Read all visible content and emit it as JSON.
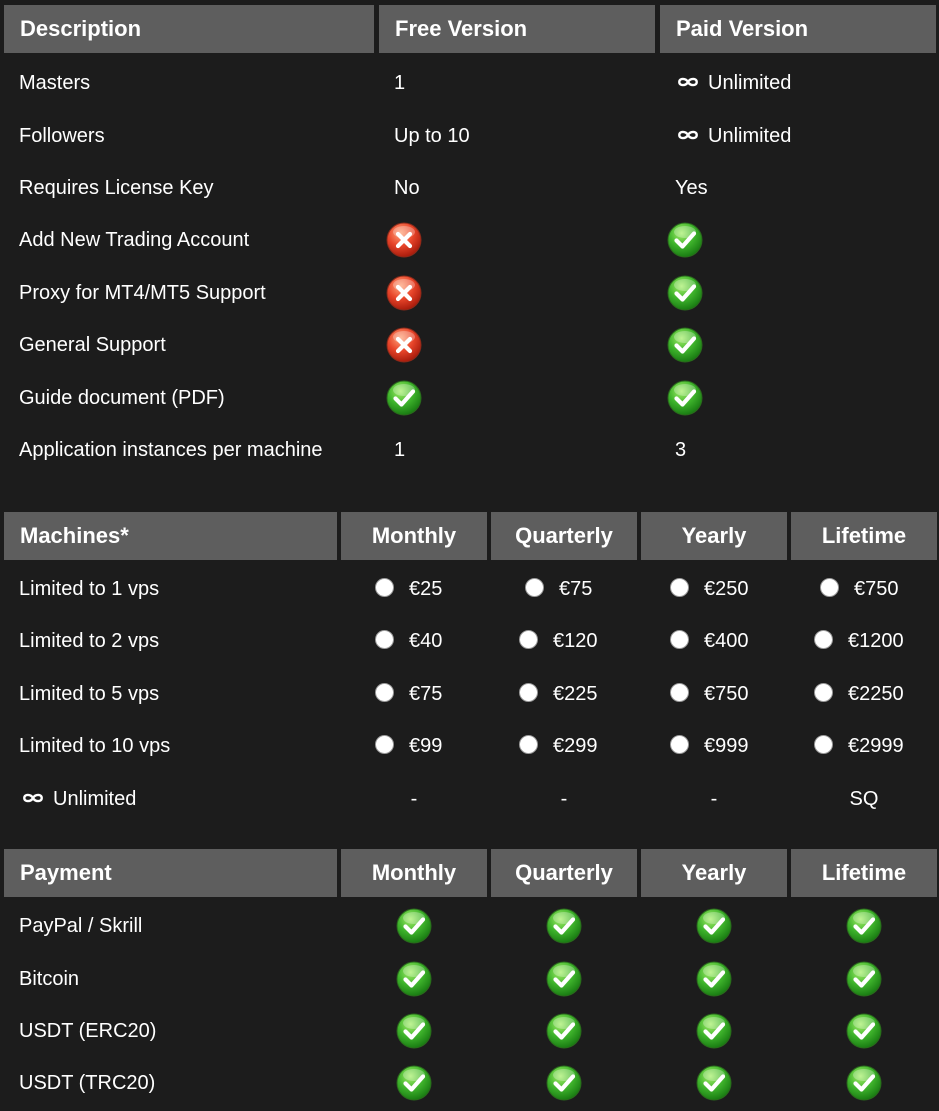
{
  "features": {
    "headers": [
      "Description",
      "Free Version",
      "Paid Version"
    ],
    "rows": [
      {
        "label": "Masters",
        "free": "1",
        "paid": "Unlimited",
        "paid_icon": "infinity-icon"
      },
      {
        "label": "Followers",
        "free": "Up to 10",
        "paid": "Unlimited",
        "paid_icon": "infinity-icon"
      },
      {
        "label": "Requires License Key",
        "free": "No",
        "paid": "Yes"
      },
      {
        "label": "Add New Trading Account",
        "free_icon": "cross-icon",
        "paid_icon": "check-icon"
      },
      {
        "label": "Proxy for MT4/MT5 Support",
        "free_icon": "cross-icon",
        "paid_icon": "check-icon"
      },
      {
        "label": "General Support",
        "free_icon": "cross-icon",
        "paid_icon": "check-icon"
      },
      {
        "label": "Guide document (PDF)",
        "free_icon": "check-icon",
        "paid_icon": "check-icon"
      },
      {
        "label": "Application instances per machine",
        "free": "1",
        "paid": "3"
      }
    ]
  },
  "machines": {
    "headers": [
      "Machines*",
      "Monthly",
      "Quarterly",
      "Yearly",
      "Lifetime"
    ],
    "rows": [
      {
        "label": "Limited to 1 vps",
        "prices": [
          "€25",
          "€75",
          "€250",
          "€750"
        ]
      },
      {
        "label": "Limited to 2 vps",
        "prices": [
          "€40",
          "€120",
          "€400",
          "€1200"
        ]
      },
      {
        "label": "Limited to 5 vps",
        "prices": [
          "€75",
          "€225",
          "€750",
          "€2250"
        ]
      },
      {
        "label": "Limited to 10 vps",
        "prices": [
          "€99",
          "€299",
          "€999",
          "€2999"
        ]
      }
    ],
    "unlimited": {
      "label": "Unlimited",
      "icon": "infinity-icon",
      "values": [
        "-",
        "-",
        "-",
        "SQ"
      ]
    }
  },
  "payment": {
    "headers": [
      "Payment",
      "Monthly",
      "Quarterly",
      "Yearly",
      "Lifetime"
    ],
    "rows": [
      {
        "label": "PayPal / Skrill",
        "icon": "check-icon"
      },
      {
        "label": "Bitcoin",
        "icon": "check-icon"
      },
      {
        "label": "USDT (ERC20)",
        "icon": "check-icon"
      },
      {
        "label": "USDT (TRC20)",
        "icon": "check-icon"
      }
    ]
  },
  "colors": {
    "page_background": "#1c1c1c",
    "header_background": "#5e5e5e",
    "text": "#ffffff",
    "check_green": "#2e9e1e",
    "cross_red": "#d8361f"
  }
}
